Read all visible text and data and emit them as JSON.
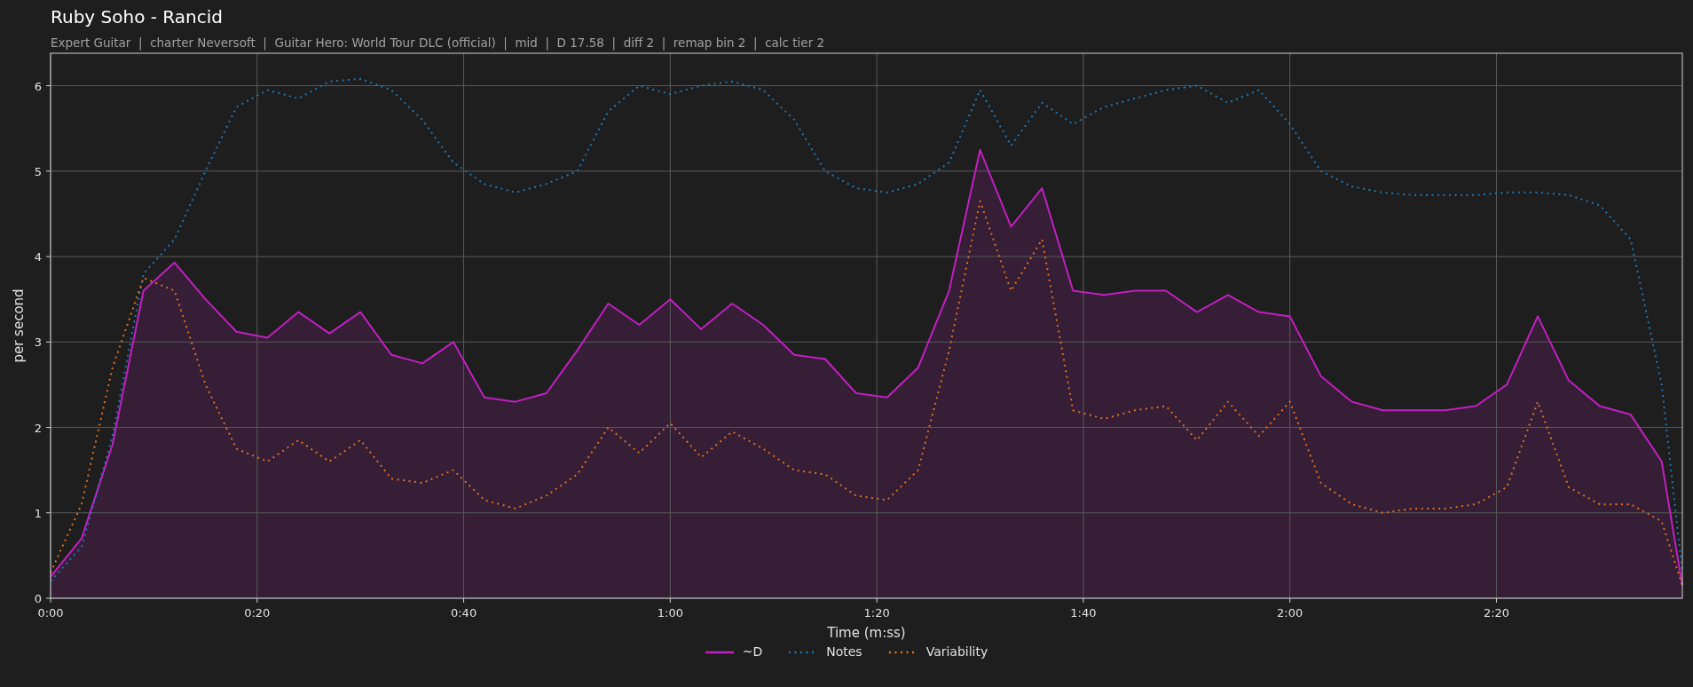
{
  "title": "Ruby Soho - Rancid",
  "subtitle": "Expert Guitar  |  charter Neversoft  |  Guitar Hero: World Tour DLC (official)  |  mid  |  D 17.58  |  diff 2  |  remap bin 2  |  calc tier 2",
  "chart_data": {
    "type": "line",
    "xlabel": "Time (m:ss)",
    "ylabel": "per second",
    "x": [
      0,
      3,
      6,
      9,
      12,
      15,
      18,
      21,
      24,
      27,
      30,
      33,
      36,
      39,
      42,
      45,
      48,
      51,
      54,
      57,
      60,
      63,
      66,
      69,
      72,
      75,
      78,
      81,
      84,
      87,
      90,
      93,
      96,
      99,
      102,
      105,
      108,
      111,
      114,
      117,
      120,
      123,
      126,
      129,
      132,
      135,
      138,
      141,
      144,
      147,
      150,
      153,
      156,
      158
    ],
    "series": [
      {
        "name": "~D",
        "color": "#c020c0",
        "type": "area",
        "line_style": "solid",
        "values": [
          0.25,
          0.7,
          1.8,
          3.6,
          3.93,
          3.5,
          3.12,
          3.05,
          3.35,
          3.1,
          3.35,
          2.85,
          2.75,
          3.0,
          2.35,
          2.3,
          2.4,
          2.9,
          3.45,
          3.2,
          3.5,
          3.15,
          3.45,
          3.2,
          2.85,
          2.8,
          2.4,
          2.35,
          2.7,
          3.6,
          5.25,
          4.35,
          4.8,
          3.6,
          3.55,
          3.6,
          3.6,
          3.35,
          3.55,
          3.35,
          3.3,
          2.6,
          2.3,
          2.2,
          2.2,
          2.2,
          2.25,
          2.5,
          3.3,
          2.55,
          2.25,
          2.15,
          1.6,
          0.15
        ]
      },
      {
        "name": "Notes",
        "color": "#1f77b4",
        "type": "line",
        "line_style": "dotted",
        "values": [
          0.2,
          0.6,
          1.9,
          3.8,
          4.2,
          5.0,
          5.75,
          5.95,
          5.85,
          6.05,
          6.08,
          5.95,
          5.6,
          5.1,
          4.85,
          4.75,
          4.85,
          5.0,
          5.7,
          6.0,
          5.9,
          6.0,
          6.05,
          5.95,
          5.6,
          5.0,
          4.8,
          4.75,
          4.85,
          5.1,
          5.95,
          5.3,
          5.8,
          5.55,
          5.75,
          5.85,
          5.95,
          6.0,
          5.8,
          5.95,
          5.55,
          5.0,
          4.82,
          4.75,
          4.72,
          4.72,
          4.72,
          4.75,
          4.75,
          4.72,
          4.6,
          4.2,
          2.5,
          0.3
        ]
      },
      {
        "name": "Variability",
        "color": "#e07020",
        "type": "line",
        "line_style": "dotted",
        "values": [
          0.3,
          1.1,
          2.7,
          3.75,
          3.6,
          2.5,
          1.75,
          1.6,
          1.85,
          1.6,
          1.85,
          1.4,
          1.35,
          1.5,
          1.15,
          1.05,
          1.2,
          1.45,
          2.0,
          1.7,
          2.05,
          1.65,
          1.95,
          1.75,
          1.5,
          1.45,
          1.2,
          1.15,
          1.5,
          2.9,
          4.65,
          3.6,
          4.2,
          2.2,
          2.1,
          2.2,
          2.25,
          1.85,
          2.3,
          1.9,
          2.3,
          1.35,
          1.1,
          1.0,
          1.05,
          1.05,
          1.1,
          1.3,
          2.3,
          1.3,
          1.1,
          1.1,
          0.9,
          0.15
        ]
      }
    ],
    "grid": true,
    "legend": true,
    "xlim": [
      0,
      158
    ],
    "ylim": [
      0,
      6.38
    ],
    "xticks": [
      {
        "value": 0,
        "label": "0:00"
      },
      {
        "value": 20,
        "label": "0:20"
      },
      {
        "value": 40,
        "label": "0:40"
      },
      {
        "value": 60,
        "label": "1:00"
      },
      {
        "value": 80,
        "label": "1:20"
      },
      {
        "value": 100,
        "label": "1:40"
      },
      {
        "value": 120,
        "label": "2:00"
      },
      {
        "value": 140,
        "label": "2:20"
      }
    ],
    "yticks": [
      0,
      1,
      2,
      3,
      4,
      5,
      6
    ]
  }
}
